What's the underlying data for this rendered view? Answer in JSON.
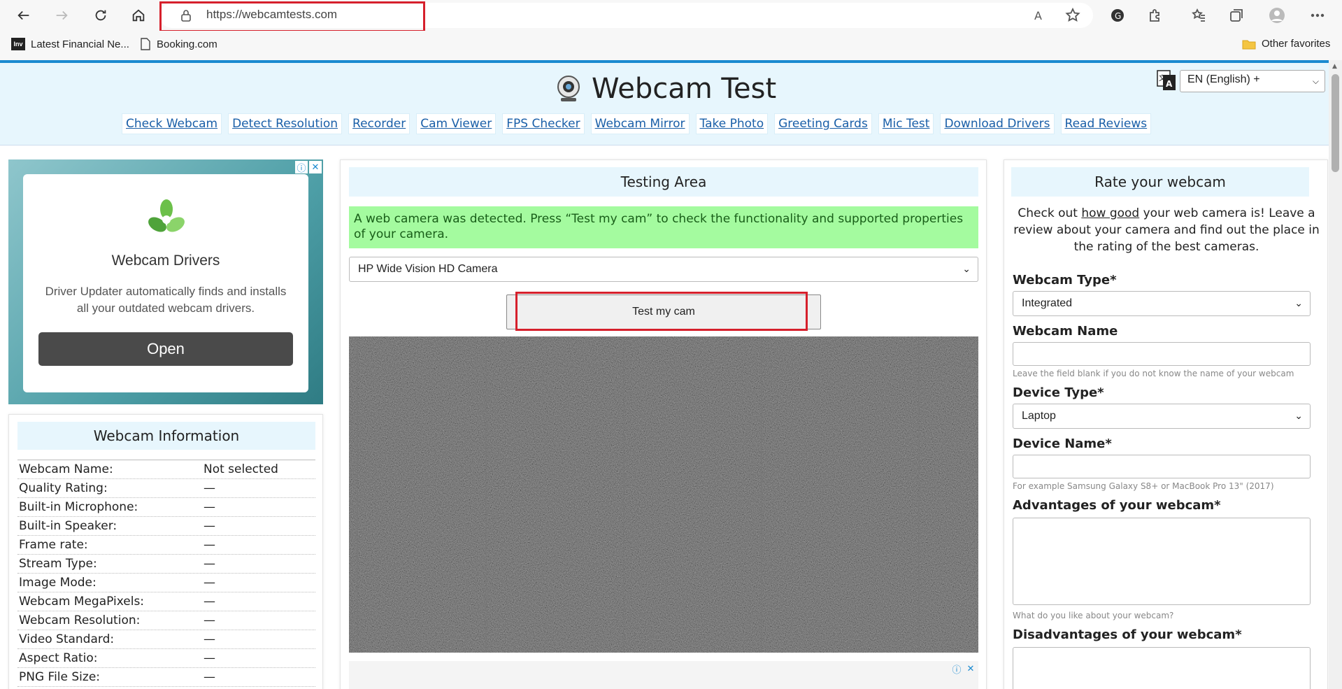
{
  "browser": {
    "url": "https://webcamtests.com",
    "bookmarks": [
      "Latest Financial Ne...",
      "Booking.com"
    ],
    "bookmark_inv_label": "Inv",
    "other_favorites": "Other favorites",
    "read_aloud": "A"
  },
  "header": {
    "title": "Webcam Test",
    "language": "EN (English) +",
    "nav": [
      "Check Webcam",
      "Detect Resolution",
      "Recorder",
      "Cam Viewer",
      "FPS Checker",
      "Webcam Mirror",
      "Take Photo",
      "Greeting Cards",
      "Mic Test",
      "Download Drivers",
      "Read Reviews"
    ]
  },
  "ad": {
    "title": "Webcam Drivers",
    "text": "Driver Updater automatically finds and installs all your outdated webcam drivers.",
    "button": "Open",
    "info_glyph": "ⓘ",
    "close_glyph": "✕"
  },
  "webcam_info": {
    "title": "Webcam Information",
    "rows": [
      {
        "k": "Webcam Name:",
        "v": "Not selected"
      },
      {
        "k": "Quality Rating:",
        "v": "—"
      },
      {
        "k": "Built-in Microphone:",
        "v": "—"
      },
      {
        "k": "Built-in Speaker:",
        "v": "—"
      },
      {
        "k": "Frame rate:",
        "v": "—"
      },
      {
        "k": "Stream Type:",
        "v": "—"
      },
      {
        "k": "Image Mode:",
        "v": "—"
      },
      {
        "k": "Webcam MegaPixels:",
        "v": "—"
      },
      {
        "k": "Webcam Resolution:",
        "v": "—"
      },
      {
        "k": "Video Standard:",
        "v": "—"
      },
      {
        "k": "Aspect Ratio:",
        "v": "—"
      },
      {
        "k": "PNG File Size:",
        "v": "—"
      }
    ]
  },
  "testing": {
    "title": "Testing Area",
    "detected": "A web camera was detected. Press “Test my cam” to check the functionality and supported properties of your camera.",
    "camera": "HP Wide Vision HD Camera",
    "button": "Test my cam"
  },
  "rate": {
    "title": "Rate your webcam",
    "intro_before": "Check out ",
    "intro_link": "how good",
    "intro_after": " your web camera is! Leave a review about your camera and find out the place in the rating of the best cameras.",
    "webcam_type_label": "Webcam Type*",
    "webcam_type_value": "Integrated",
    "webcam_name_label": "Webcam Name",
    "webcam_name_hint": "Leave the field blank if you do not know the name of your webcam",
    "device_type_label": "Device Type*",
    "device_type_value": "Laptop",
    "device_name_label": "Device Name*",
    "device_name_hint": "For example Samsung Galaxy S8+ or MacBook Pro 13\" (2017)",
    "advantages_label": "Advantages of your webcam*",
    "advantages_hint": "What do you like about your webcam?",
    "disadvantages_label": "Disadvantages of your webcam*"
  },
  "colors": {
    "accent": "#1a8ad0",
    "header_bg": "#e7f6fd",
    "detected_bg": "#a4fb9f",
    "highlight": "#d6202c"
  }
}
